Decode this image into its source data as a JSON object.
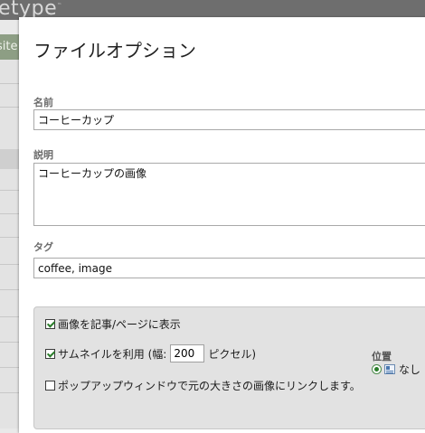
{
  "background": {
    "logo_text": "etype",
    "logo_mark": "™",
    "site_tab": "site"
  },
  "dialog": {
    "title": "ファイルオプション",
    "name": {
      "label": "名前",
      "value": "コーヒーカップ"
    },
    "description": {
      "label": "説明",
      "value": "コーヒーカップの画像"
    },
    "tags": {
      "label": "タグ",
      "value": "coffee, image"
    },
    "options": {
      "show_in_post": {
        "label": "画像を記事/ページに表示",
        "checked": true
      },
      "thumbnail": {
        "label_before": "サムネイルを利用 (幅:",
        "width_value": "200",
        "label_after": "ピクセル)",
        "checked": true
      },
      "popup": {
        "label": "ポップアップウィンドウで元の大きさの画像にリンクします。",
        "checked": false
      },
      "position": {
        "label": "位置",
        "selected": "なし"
      }
    }
  }
}
